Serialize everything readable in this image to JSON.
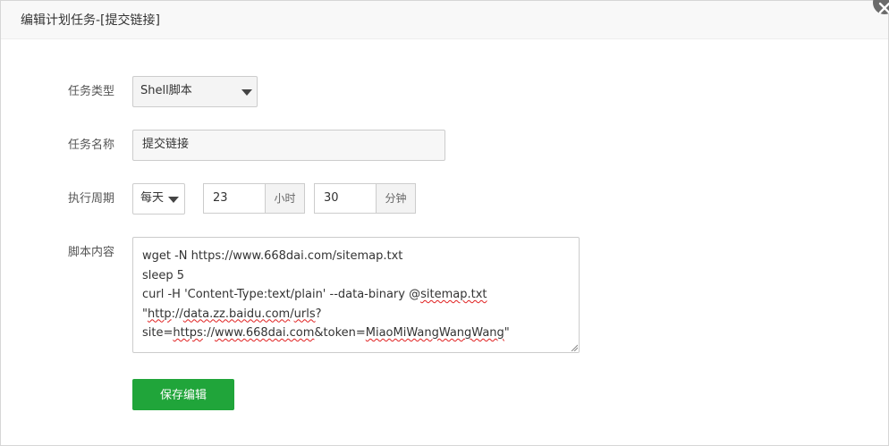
{
  "dialog": {
    "title": "编辑计划任务-[提交链接]",
    "close_label": "×"
  },
  "form": {
    "task_type": {
      "label": "任务类型",
      "selected": "Shell脚本"
    },
    "task_name": {
      "label": "任务名称",
      "value": "提交链接"
    },
    "schedule": {
      "label": "执行周期",
      "period_selected": "每天",
      "hour_value": "23",
      "hour_unit": "小时",
      "minute_value": "30",
      "minute_unit": "分钟"
    },
    "script": {
      "label": "脚本内容",
      "lines": [
        "wget -N https://www.668dai.com/sitemap.txt",
        "sleep 5",
        "curl -H 'Content-Type:text/plain' --data-binary @sitemap.txt",
        "\"http://data.zz.baidu.com/urls?",
        "site=https://www.668dai.com&token=MiaoMiWangWangWang\""
      ],
      "parts": {
        "l3_pre": "curl -H 'Content-Type:text/plain' --data-binary @",
        "l3_spell": "sitemap.txt",
        "l4_q": "\"",
        "l4_http": "http",
        "l4_mid": "://",
        "l4_domain": "data.zz.baidu.com",
        "l4_slash": "/",
        "l4_urls": "urls",
        "l4_end": "?",
        "l5_site": "site=",
        "l5_https": "https",
        "l5_sep": "://",
        "l5_www": "www.668dai.com",
        "l5_tok": "&token=",
        "l5_tokval": "MiaoMiWangWangWang",
        "l5_end": "\""
      }
    },
    "save_button": "保存编辑"
  },
  "colors": {
    "primary_green": "#20a53a",
    "header_bg": "#f8f8f8",
    "border": "#cccccc"
  }
}
